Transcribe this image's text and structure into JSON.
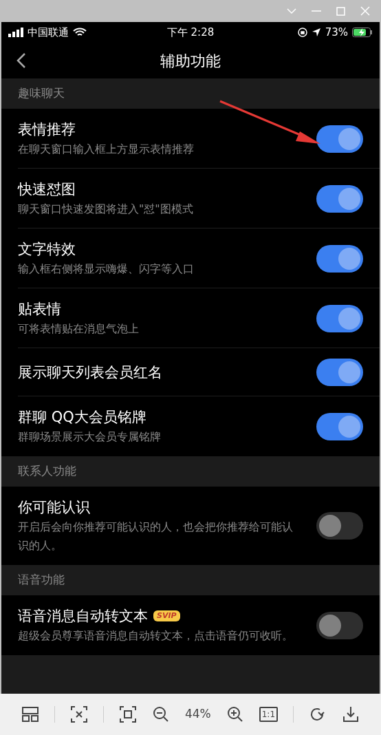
{
  "status_bar": {
    "carrier": "中国联通",
    "time": "下午 2:28",
    "battery": "73%"
  },
  "nav": {
    "title": "辅助功能"
  },
  "sections": [
    {
      "title": "趣味聊天",
      "items": [
        {
          "title": "表情推荐",
          "subtitle": "在聊天窗口输入框上方显示表情推荐",
          "on": true
        },
        {
          "title": "快速怼图",
          "subtitle": "聊天窗口快速发图将进入\"怼\"图模式",
          "on": true
        },
        {
          "title": "文字特效",
          "subtitle": "输入框右侧将显示嗨爆、闪字等入口",
          "on": true
        },
        {
          "title": "贴表情",
          "subtitle": "可将表情贴在消息气泡上",
          "on": true
        },
        {
          "title": "展示聊天列表会员红名",
          "on": true
        },
        {
          "title": "群聊 QQ大会员铭牌",
          "subtitle": "群聊场景展示大会员专属铭牌",
          "on": true
        }
      ]
    },
    {
      "title": "联系人功能",
      "items": [
        {
          "title": "你可能认识",
          "subtitle": "开启后会向你推荐可能认识的人，也会把你推荐给可能认识的人。",
          "on": false
        }
      ]
    },
    {
      "title": "语音功能",
      "items": [
        {
          "title": "语音消息自动转文本",
          "badge": "SVIP",
          "subtitle": "超级会员尊享语音消息自动转文本，点击语音仍可收听。",
          "on": false
        }
      ]
    }
  ],
  "toolbar": {
    "zoom": "44%",
    "actual_size": "1:1"
  }
}
